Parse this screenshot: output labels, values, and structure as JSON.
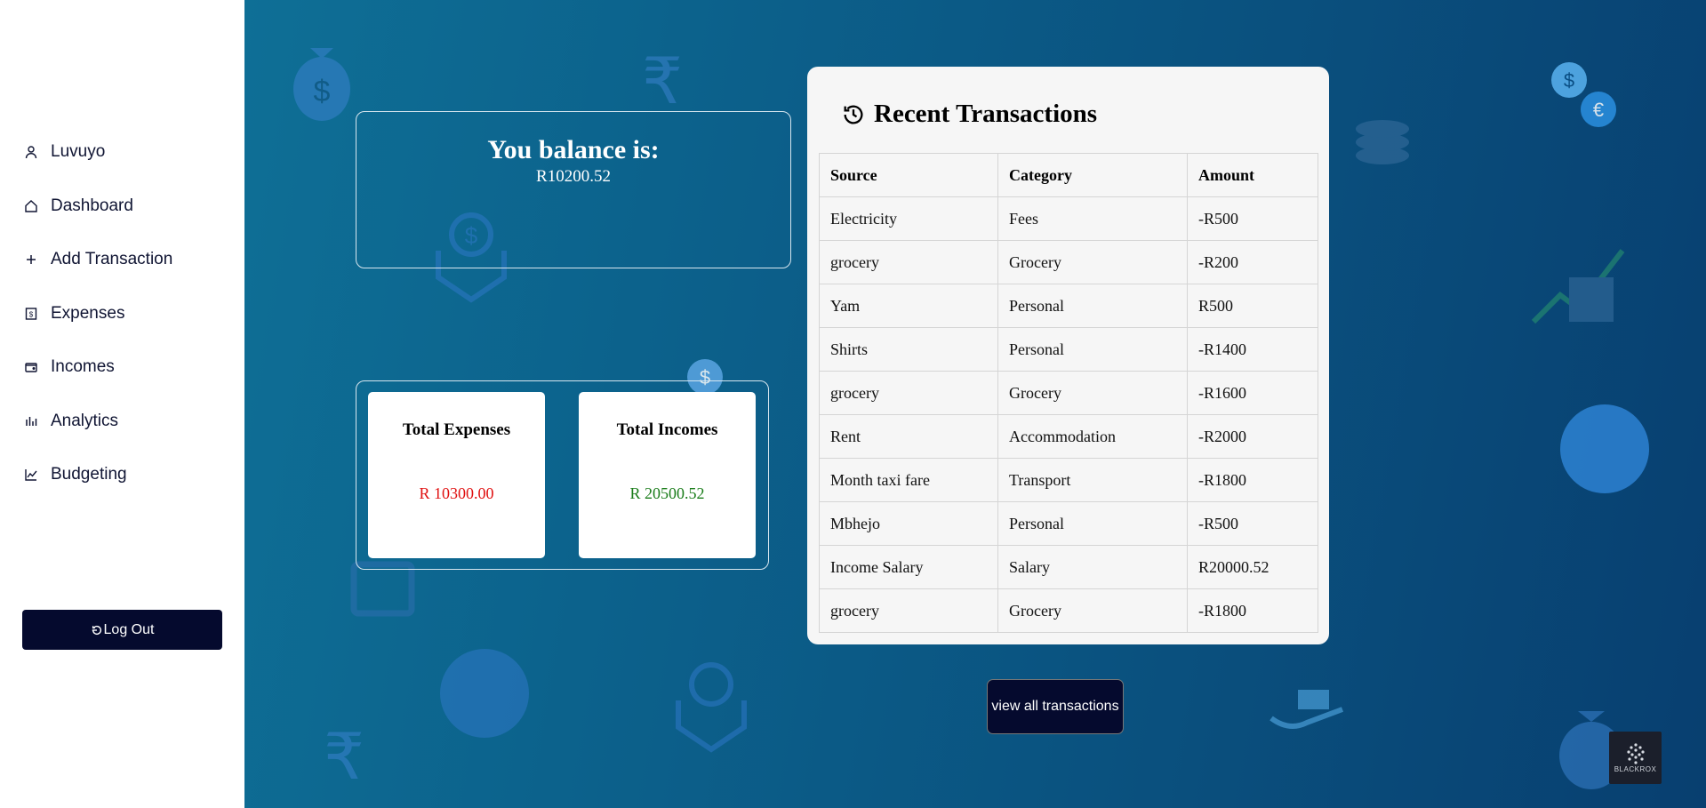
{
  "sidebar": {
    "items": [
      {
        "label": "Luvuyo",
        "icon": "user-icon"
      },
      {
        "label": "Dashboard",
        "icon": "home-icon"
      },
      {
        "label": "Add Transaction",
        "icon": "plus-icon"
      },
      {
        "label": "Expenses",
        "icon": "receipt-icon"
      },
      {
        "label": "Incomes",
        "icon": "wallet-icon"
      },
      {
        "label": "Analytics",
        "icon": "bar-chart-icon"
      },
      {
        "label": "Budgeting",
        "icon": "line-chart-icon"
      }
    ],
    "logout_label": "Log Out"
  },
  "balance": {
    "title": "You balance is:",
    "value": "R10200.52"
  },
  "totals": {
    "expenses_label": "Total Expenses",
    "expenses_value": "R 10300.00",
    "incomes_label": "Total Incomes",
    "incomes_value": "R 20500.52"
  },
  "transactions": {
    "title": "Recent Transactions",
    "columns": [
      "Source",
      "Category",
      "Amount"
    ],
    "rows": [
      {
        "source": "Electricity",
        "category": "Fees",
        "amount": "-R500"
      },
      {
        "source": "grocery",
        "category": "Grocery",
        "amount": "-R200"
      },
      {
        "source": "Yam",
        "category": "Personal",
        "amount": "R500"
      },
      {
        "source": "Shirts",
        "category": "Personal",
        "amount": "-R1400"
      },
      {
        "source": "grocery",
        "category": "Grocery",
        "amount": "-R1600"
      },
      {
        "source": "Rent",
        "category": "Accommodation",
        "amount": "-R2000"
      },
      {
        "source": "Month taxi fare",
        "category": "Transport",
        "amount": "-R1800"
      },
      {
        "source": "Mbhejo",
        "category": "Personal",
        "amount": "-R500"
      },
      {
        "source": "Income Salary",
        "category": "Salary",
        "amount": "R20000.52"
      },
      {
        "source": "grocery",
        "category": "Grocery",
        "amount": "-R1800"
      }
    ],
    "view_all_label": "view all transactions"
  },
  "brand": {
    "label": "BLACKROX"
  },
  "colors": {
    "negative": "#e01010",
    "positive": "#1b7d1b",
    "dark_button": "#050a2e"
  }
}
